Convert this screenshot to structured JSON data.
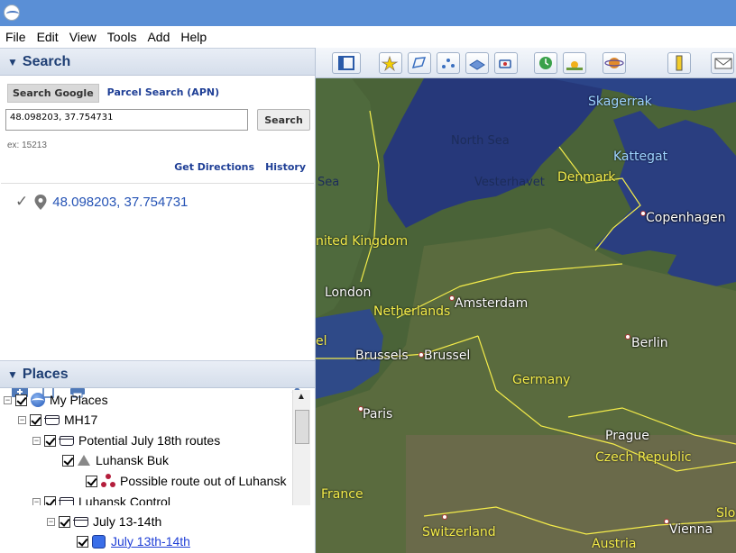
{
  "menu": [
    "File",
    "Edit",
    "View",
    "Tools",
    "Add",
    "Help"
  ],
  "search_panel": {
    "title": "Search",
    "tabs": [
      "Search Google",
      "Parcel Search (APN)"
    ],
    "input_value": "48.098203, 37.754731",
    "button_label": "Search",
    "example": "ex: 15213",
    "links": [
      "Get Directions",
      "History"
    ],
    "result": "48.098203, 37.754731"
  },
  "places_panel": {
    "title": "Places",
    "items": [
      {
        "label": "My Places",
        "icon": "globe-icon"
      },
      {
        "label": "MH17",
        "icon": "folder-icon"
      },
      {
        "label": "Potential July 18th routes",
        "icon": "folder-icon"
      },
      {
        "label": "Luhansk Buk",
        "icon": "warning-icon"
      },
      {
        "label": "Possible route out of Luhansk",
        "icon": "route-icon"
      },
      {
        "label": "Luhansk Control",
        "icon": "folder-icon"
      },
      {
        "label": "July 13-14th",
        "icon": "folder-icon"
      },
      {
        "label": "July 13th-14th",
        "icon": "polygon-icon"
      }
    ]
  },
  "map": {
    "labels": {
      "skagerrak": "Skagerrak",
      "north_sea": "North Sea",
      "kattegat": "Kattegat",
      "vesterhavet": "Vesterhavet",
      "denmark": "Denmark",
      "sea": "Sea",
      "copenhagen": "Copenhagen",
      "united_kingdom": "nited Kingdom",
      "london": "London",
      "amsterdam": "Amsterdam",
      "netherlands": "Netherlands",
      "el": "el",
      "brussels": "Brussels",
      "brussel": "Brussel",
      "berlin": "Berlin",
      "germany": "Germany",
      "paris": "Paris",
      "prague": "Prague",
      "czech_republic": "Czech Republic",
      "france": "France",
      "switzerland": "Switzerland",
      "vienna": "Vienna",
      "austria": "Austria",
      "slo": "Slo"
    }
  },
  "colors": {
    "titlebar": "#5a8fd6",
    "panel_header_text": "#1f3f74",
    "link_blue": "#1f3f96",
    "water": "#26387a",
    "border_yellow": "#f4ec4a"
  }
}
